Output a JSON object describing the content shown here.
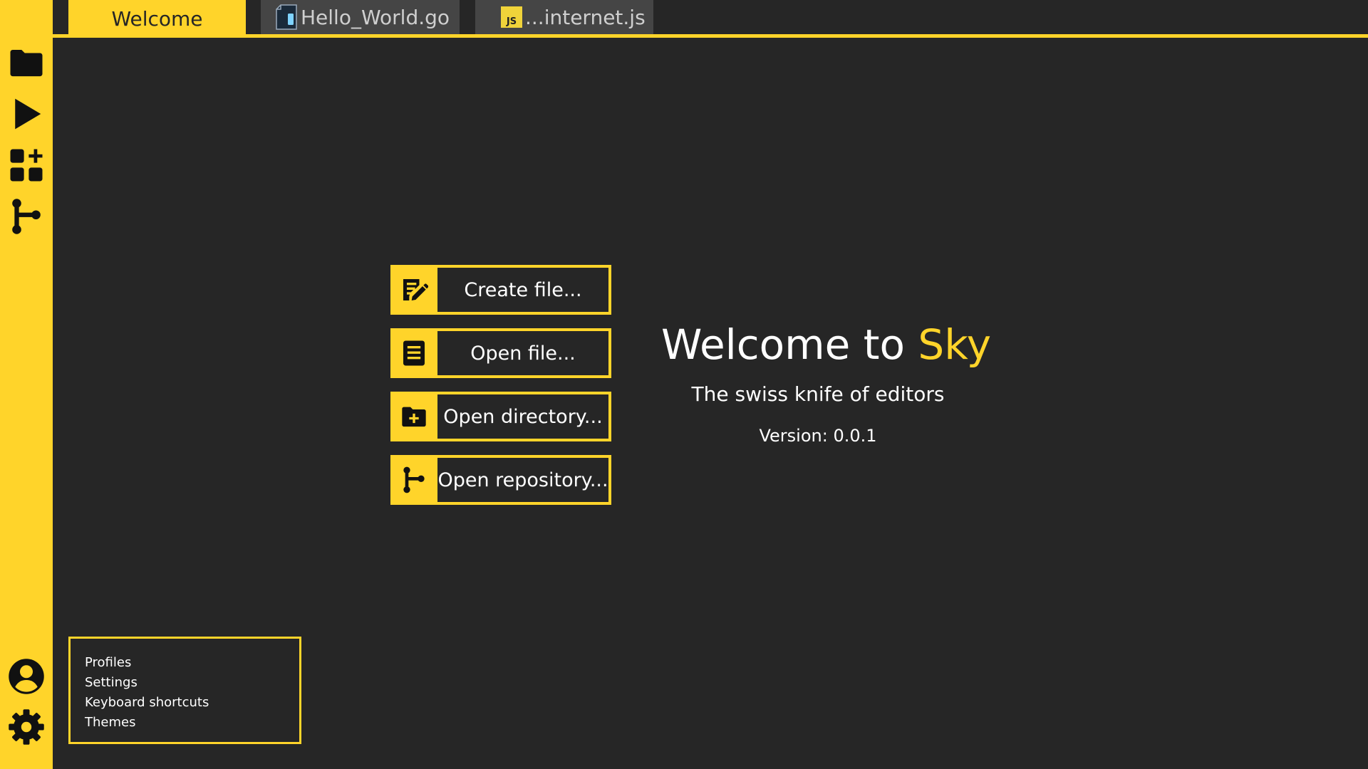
{
  "colors": {
    "accent": "#ffd42a",
    "background": "#262626",
    "tab_inactive": "#454545",
    "text": "#ffffff"
  },
  "activity_bar": {
    "top_icons": [
      "folder-icon",
      "play-icon",
      "extensions-icon",
      "git-branch-icon"
    ],
    "bottom_icons": [
      "account-icon",
      "settings-gear-icon"
    ]
  },
  "tabs": [
    {
      "label": "Welcome",
      "active": true
    },
    {
      "label": "Hello_World.go",
      "active": false,
      "icon": "go-file-icon"
    },
    {
      "label": "...internet.js",
      "active": false,
      "icon": "js-file-icon",
      "icon_text": "JS"
    }
  ],
  "actions": [
    {
      "label": "Create file...",
      "icon": "edit-note-icon"
    },
    {
      "label": "Open file...",
      "icon": "document-icon"
    },
    {
      "label": "Open directory...",
      "icon": "folder-plus-icon"
    },
    {
      "label": "Open repository...",
      "icon": "git-branch-icon"
    }
  ],
  "hero": {
    "title_prefix": "Welcome to ",
    "title_accent": "Sky",
    "subtitle": "The swiss knife of editors",
    "version": "Version: 0.0.1"
  },
  "settings_menu": {
    "items": [
      "Profiles",
      "Settings",
      "Keyboard shortcuts",
      "Themes"
    ]
  }
}
